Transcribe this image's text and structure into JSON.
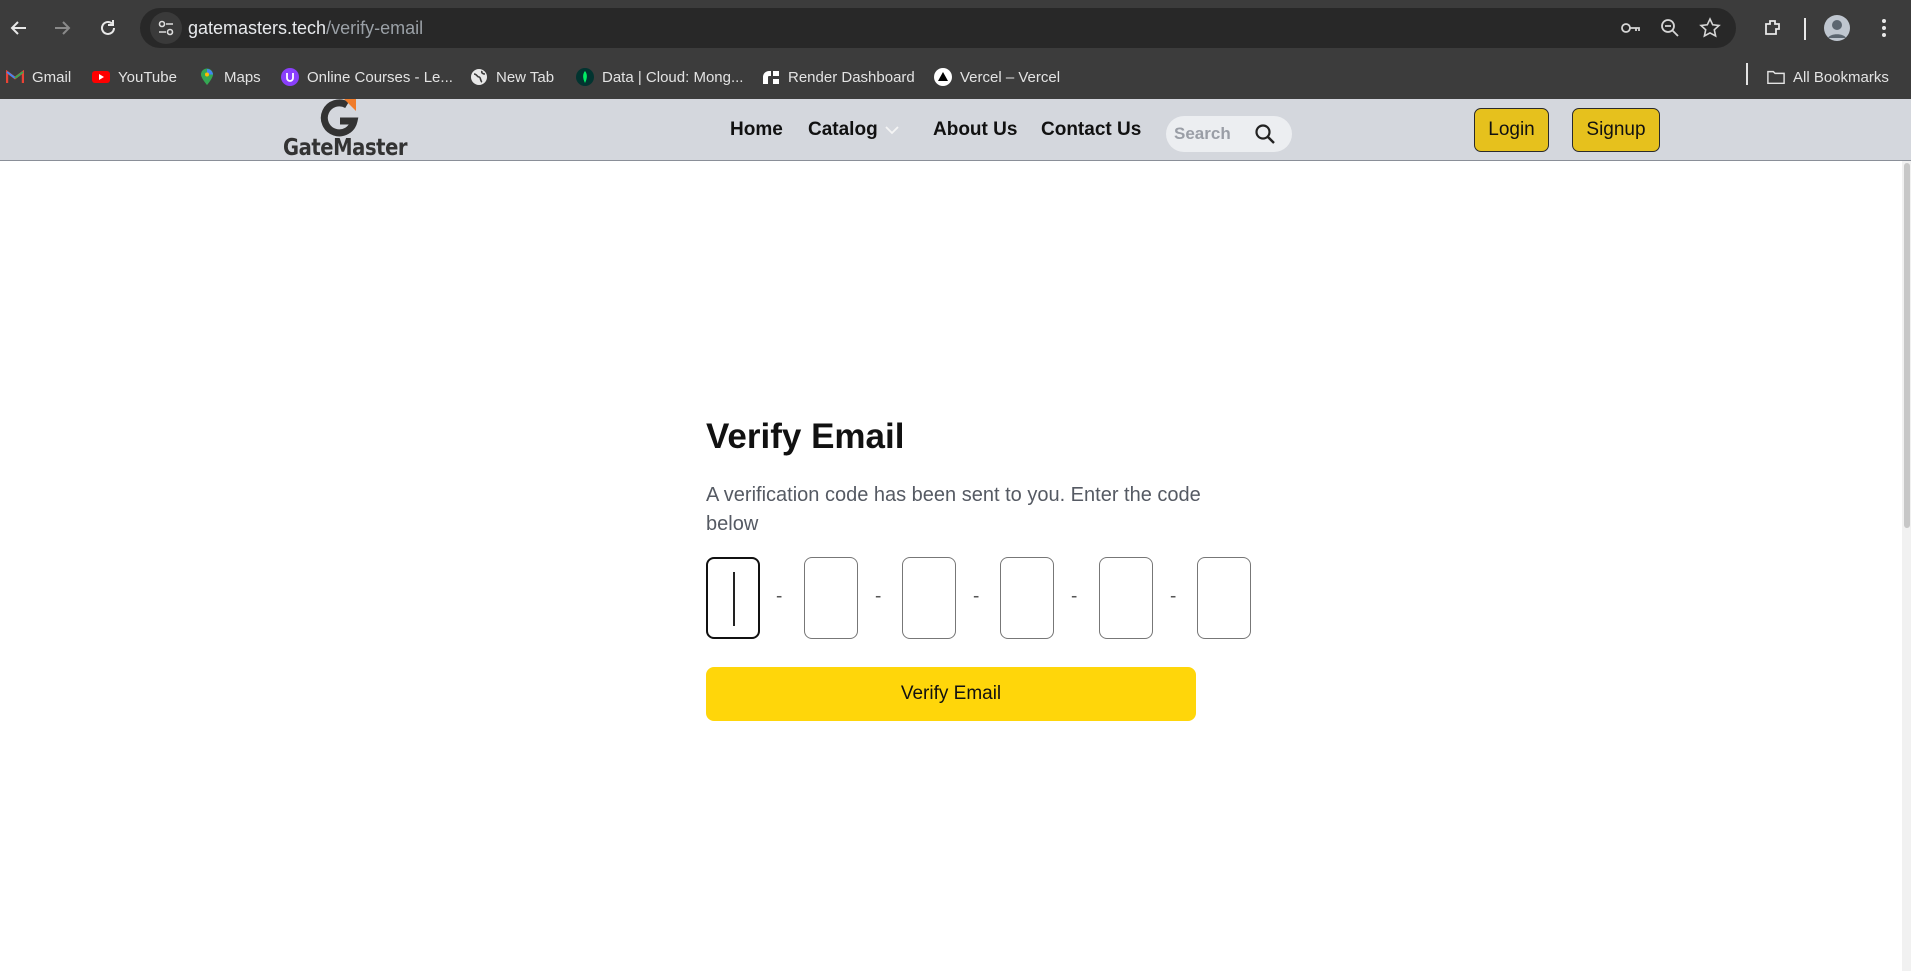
{
  "browser": {
    "url_domain": "gatemasters.tech",
    "url_path": "/verify-email",
    "nav_icons": [
      "back-icon",
      "forward-icon",
      "reload-icon"
    ],
    "omnibox_icons": [
      "site-settings-icon",
      "password-key-icon",
      "zoom-icon",
      "bookmark-star-icon"
    ],
    "toolbar_icons": [
      "extensions-icon",
      "profile-avatar-icon",
      "menu-icon"
    ]
  },
  "bookmarks": {
    "items": [
      {
        "label": "Gmail",
        "icon": "gmail-icon"
      },
      {
        "label": "YouTube",
        "icon": "youtube-icon"
      },
      {
        "label": "Maps",
        "icon": "maps-icon"
      },
      {
        "label": "Online Courses - Le...",
        "icon": "courses-icon"
      },
      {
        "label": "New Tab",
        "icon": "globe-icon"
      },
      {
        "label": "Data | Cloud: Mong...",
        "icon": "mongodb-icon"
      },
      {
        "label": "Render Dashboard",
        "icon": "render-icon"
      },
      {
        "label": "Vercel – Vercel",
        "icon": "vercel-icon"
      }
    ],
    "all_bookmarks": "All Bookmarks"
  },
  "site": {
    "logo_text": "GateMaster",
    "nav": {
      "home": "Home",
      "catalog": "Catalog",
      "about": "About Us",
      "contact": "Contact Us"
    },
    "search_placeholder": "Search",
    "login": "Login",
    "signup": "Signup"
  },
  "verify": {
    "title": "Verify Email",
    "description": "A verification code has been sent to you. Enter the code below",
    "otp_separator": "-",
    "button": "Verify Email"
  },
  "colors": {
    "header_bg": "#d4d7dd",
    "auth_button": "#e6c11d",
    "primary_button": "#ffd60a",
    "logo_accent": "#f07c2a"
  }
}
